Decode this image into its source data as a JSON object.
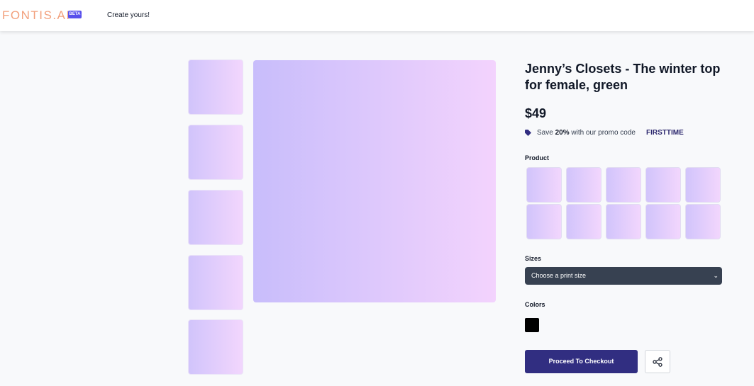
{
  "header": {
    "logo_text": "FONTIS.AI",
    "beta_badge": "BETA",
    "nav_link": "Create yours!"
  },
  "gallery": {
    "thumbnails": 5,
    "gradient_start": "#c8bdfb",
    "gradient_end": "#f3d3fd"
  },
  "product": {
    "title": "Jenny’s Closets - The winter top for female, green",
    "price": "$49",
    "promo_prefix": "Save ",
    "promo_percent": "20%",
    "promo_suffix": " with our promo code",
    "promo_code": "FIRSTTIME"
  },
  "options": {
    "product_label": "Product",
    "product_swatches": 10,
    "sizes_label": "Sizes",
    "sizes_selected": "Choose a print size",
    "colors_label": "Colors",
    "color_value": "#000000"
  },
  "actions": {
    "checkout_label": "Proceed To Checkout",
    "accent_color": "#312e81"
  },
  "icons": [
    "tag-icon",
    "chevron-down-icon",
    "share-icon"
  ]
}
